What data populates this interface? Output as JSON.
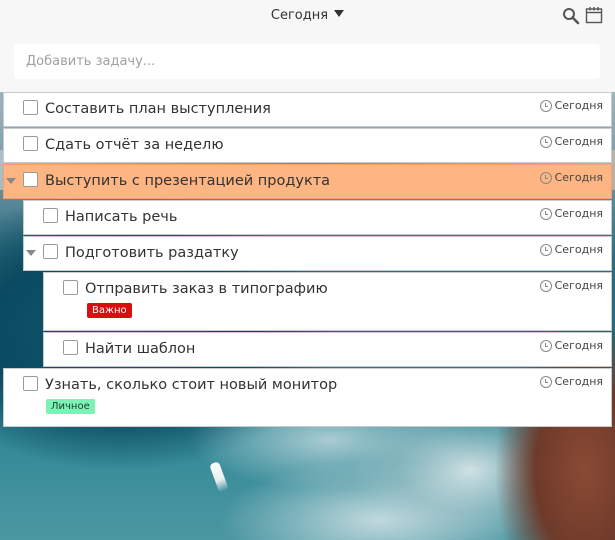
{
  "header": {
    "title": "Сегодня",
    "search_icon": "search-icon",
    "calendar_icon": "calendar-icon"
  },
  "add_task": {
    "placeholder": "Добавить задачу...",
    "value": ""
  },
  "tasks": [
    {
      "title": "Составить план выступления",
      "due": "Сегодня",
      "level": 0,
      "checked": false
    },
    {
      "title": "Сдать отчёт за неделю",
      "due": "Сегодня",
      "level": 0,
      "checked": false
    },
    {
      "title": "Выступить с презентацией продукта",
      "due": "Сегодня",
      "level": 0,
      "checked": false,
      "expanded": true,
      "selected": true
    },
    {
      "title": "Написать речь",
      "due": "Сегодня",
      "level": 1,
      "checked": false
    },
    {
      "title": "Подготовить раздатку",
      "due": "Сегодня",
      "level": 1,
      "checked": false,
      "expanded": true
    },
    {
      "title": "Отправить заказ в типографию",
      "due": "Сегодня",
      "level": 2,
      "checked": false,
      "tag": "Важно"
    },
    {
      "title": "Найти шаблон",
      "due": "Сегодня",
      "level": 2,
      "checked": false
    },
    {
      "title": "Узнать, сколько стоит новый монитор",
      "due": "Сегодня",
      "level": 0,
      "checked": false,
      "tag": "Личное"
    }
  ],
  "colors": {
    "selected_row": "#fdb583",
    "tag_important": "#d90f0f",
    "tag_personal": "#7cf2b4"
  }
}
